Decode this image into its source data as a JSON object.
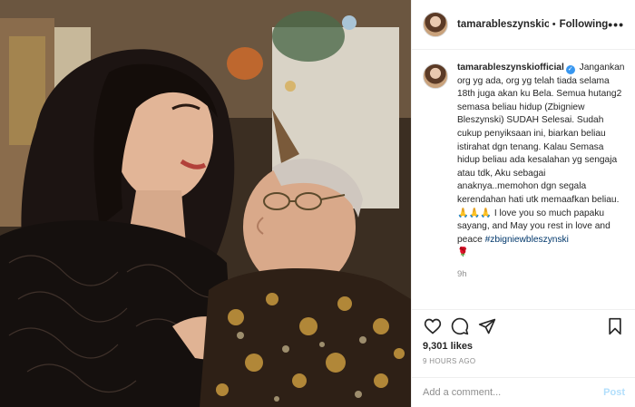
{
  "post": {
    "username": "tamarableszynskiofficial",
    "follow_label": "Following",
    "more_label": "•••",
    "caption": {
      "username": "tamarableszynskiofficial",
      "verified_mark": "✓",
      "text": "Jangankan org yg ada, org yg telah tiada selama 18th juga akan ku Bela. Semua hutang2 semasa beliau hidup (Zbigniew Bleszynski) SUDAH Selesai. Sudah cukup penyiksaan ini, biarkan beliau istirahat dgn tenang. Kalau Semasa hidup beliau ada kesalahan yg sengaja atau tdk, Aku sebagai anaknya..memohon dgn segala kerendahan hati utk memaafkan beliau. 🙏🙏🙏 I love you so much papaku sayang, and May you rest in love and peace",
      "hashtag": "#zbigniewbleszynski",
      "rose": "🌹"
    },
    "time_ago": "9h",
    "likes": "9,301 likes",
    "date": "9 HOURS AGO",
    "comment_placeholder": "Add a comment...",
    "post_label": "Post"
  },
  "icons": {
    "like": "heart-icon",
    "comment": "comment-icon",
    "share": "share-icon",
    "save": "bookmark-icon",
    "verified": "verified-badge-icon"
  },
  "colors": {
    "link": "#00376b",
    "verified": "#3897f0",
    "muted": "#8e8e8e",
    "post_disabled": "#b2dffc"
  }
}
